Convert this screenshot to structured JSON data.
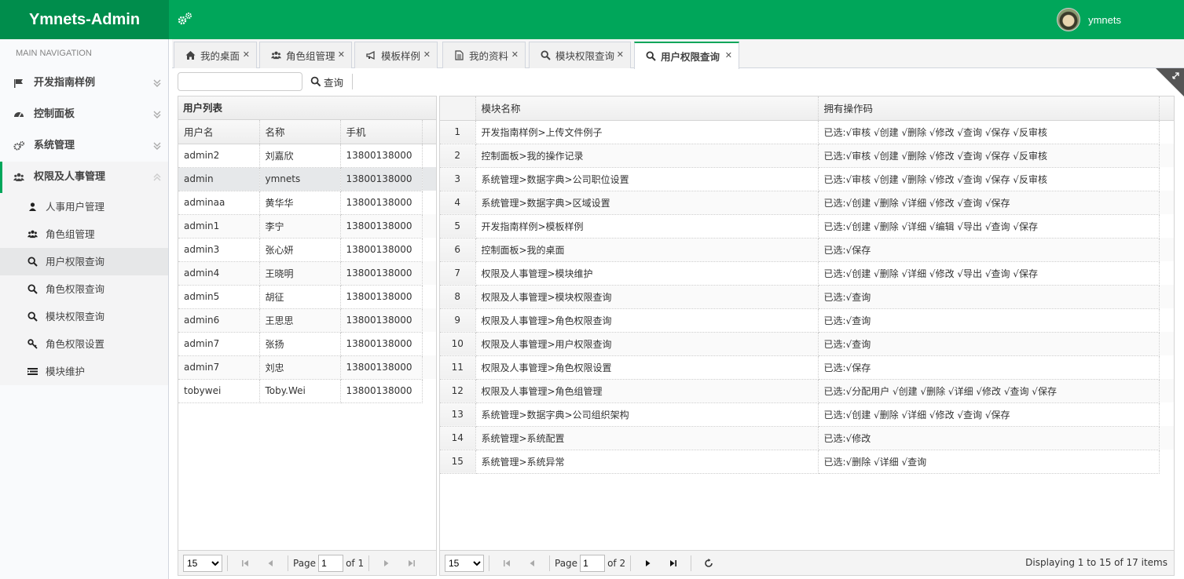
{
  "app": {
    "logo": "Ymnets-Admin",
    "user_name": "ymnets"
  },
  "sidebar": {
    "header": "MAIN NAVIGATION",
    "items": [
      {
        "label": "开发指南样例",
        "icon": "flag-icon"
      },
      {
        "label": "控制面板",
        "icon": "dashboard-icon"
      },
      {
        "label": "系统管理",
        "icon": "cogs-icon"
      },
      {
        "label": "权限及人事管理",
        "icon": "users-icon"
      }
    ],
    "subitems": [
      {
        "label": "人事用户管理",
        "icon": "user-icon"
      },
      {
        "label": "角色组管理",
        "icon": "users-icon"
      },
      {
        "label": "用户权限查询",
        "icon": "search-icon"
      },
      {
        "label": "角色权限查询",
        "icon": "search-icon"
      },
      {
        "label": "模块权限查询",
        "icon": "search-icon"
      },
      {
        "label": "角色权限设置",
        "icon": "key-icon"
      },
      {
        "label": "模块维护",
        "icon": "list-icon"
      }
    ]
  },
  "tabs": [
    {
      "label": "我的桌面",
      "icon": "home-icon"
    },
    {
      "label": "角色组管理",
      "icon": "users-icon"
    },
    {
      "label": "模板样例",
      "icon": "bullhorn-icon"
    },
    {
      "label": "我的资料",
      "icon": "file-icon"
    },
    {
      "label": "模块权限查询",
      "icon": "search-icon"
    },
    {
      "label": "用户权限查询",
      "icon": "search-icon"
    }
  ],
  "toolbar": {
    "search_value": "",
    "search_label": "查询"
  },
  "user_panel": {
    "title": "用户列表",
    "columns": [
      "用户名",
      "名称",
      "手机"
    ],
    "rows": [
      [
        "admin2",
        "刘嘉欣",
        "13800138000"
      ],
      [
        "admin",
        "ymnets",
        "13800138000"
      ],
      [
        "adminaa",
        "黄华华",
        "13800138000"
      ],
      [
        "admin1",
        "李宁",
        "13800138000"
      ],
      [
        "admin3",
        "张心妍",
        "13800138000"
      ],
      [
        "admin4",
        "王晓明",
        "13800138000"
      ],
      [
        "admin5",
        "胡征",
        "13800138000"
      ],
      [
        "admin6",
        "王思思",
        "13800138000"
      ],
      [
        "admin7",
        "张扬",
        "13800138000"
      ],
      [
        "admin7",
        "刘忠",
        "13800138000"
      ],
      [
        "tobywei",
        "Toby.Wei",
        "13800138000"
      ]
    ],
    "selected_index": 1,
    "pager": {
      "page_size": "15",
      "page_label": "Page",
      "page": "1",
      "of_label": "of 1"
    }
  },
  "perm_panel": {
    "columns": [
      "模块名称",
      "拥有操作码"
    ],
    "rows": [
      [
        "1",
        "开发指南样例>上传文件例子",
        "已选:√审核 √创建 √删除 √修改 √查询 √保存 √反审核"
      ],
      [
        "2",
        "控制面板>我的操作记录",
        "已选:√审核 √创建 √删除 √修改 √查询 √保存 √反审核"
      ],
      [
        "3",
        "系统管理>数据字典>公司职位设置",
        "已选:√审核 √创建 √删除 √修改 √查询 √保存 √反审核"
      ],
      [
        "4",
        "系统管理>数据字典>区域设置",
        "已选:√创建 √删除 √详细 √修改 √查询 √保存"
      ],
      [
        "5",
        "开发指南样例>模板样例",
        "已选:√创建 √删除 √详细 √编辑 √导出 √查询 √保存"
      ],
      [
        "6",
        "控制面板>我的桌面",
        "已选:√保存"
      ],
      [
        "7",
        "权限及人事管理>模块维护",
        "已选:√创建 √删除 √详细 √修改 √导出 √查询 √保存"
      ],
      [
        "8",
        "权限及人事管理>模块权限查询",
        "已选:√查询"
      ],
      [
        "9",
        "权限及人事管理>角色权限查询",
        "已选:√查询"
      ],
      [
        "10",
        "权限及人事管理>用户权限查询",
        "已选:√查询"
      ],
      [
        "11",
        "权限及人事管理>角色权限设置",
        "已选:√保存"
      ],
      [
        "12",
        "权限及人事管理>角色组管理",
        "已选:√分配用户 √创建 √删除 √详细 √修改 √查询 √保存"
      ],
      [
        "13",
        "系统管理>数据字典>公司组织架构",
        "已选:√创建 √删除 √详细 √修改 √查询 √保存"
      ],
      [
        "14",
        "系统管理>系统配置",
        "已选:√修改"
      ],
      [
        "15",
        "系统管理>系统异常",
        "已选:√删除 √详细 √查询"
      ]
    ],
    "pager": {
      "page_size": "15",
      "page_label": "Page",
      "page": "1",
      "of_label": "of 2",
      "info": "Displaying 1 to 15 of 17 items"
    }
  },
  "colors": {
    "brand": "#00a65a",
    "brand_dark": "#008d4c"
  }
}
